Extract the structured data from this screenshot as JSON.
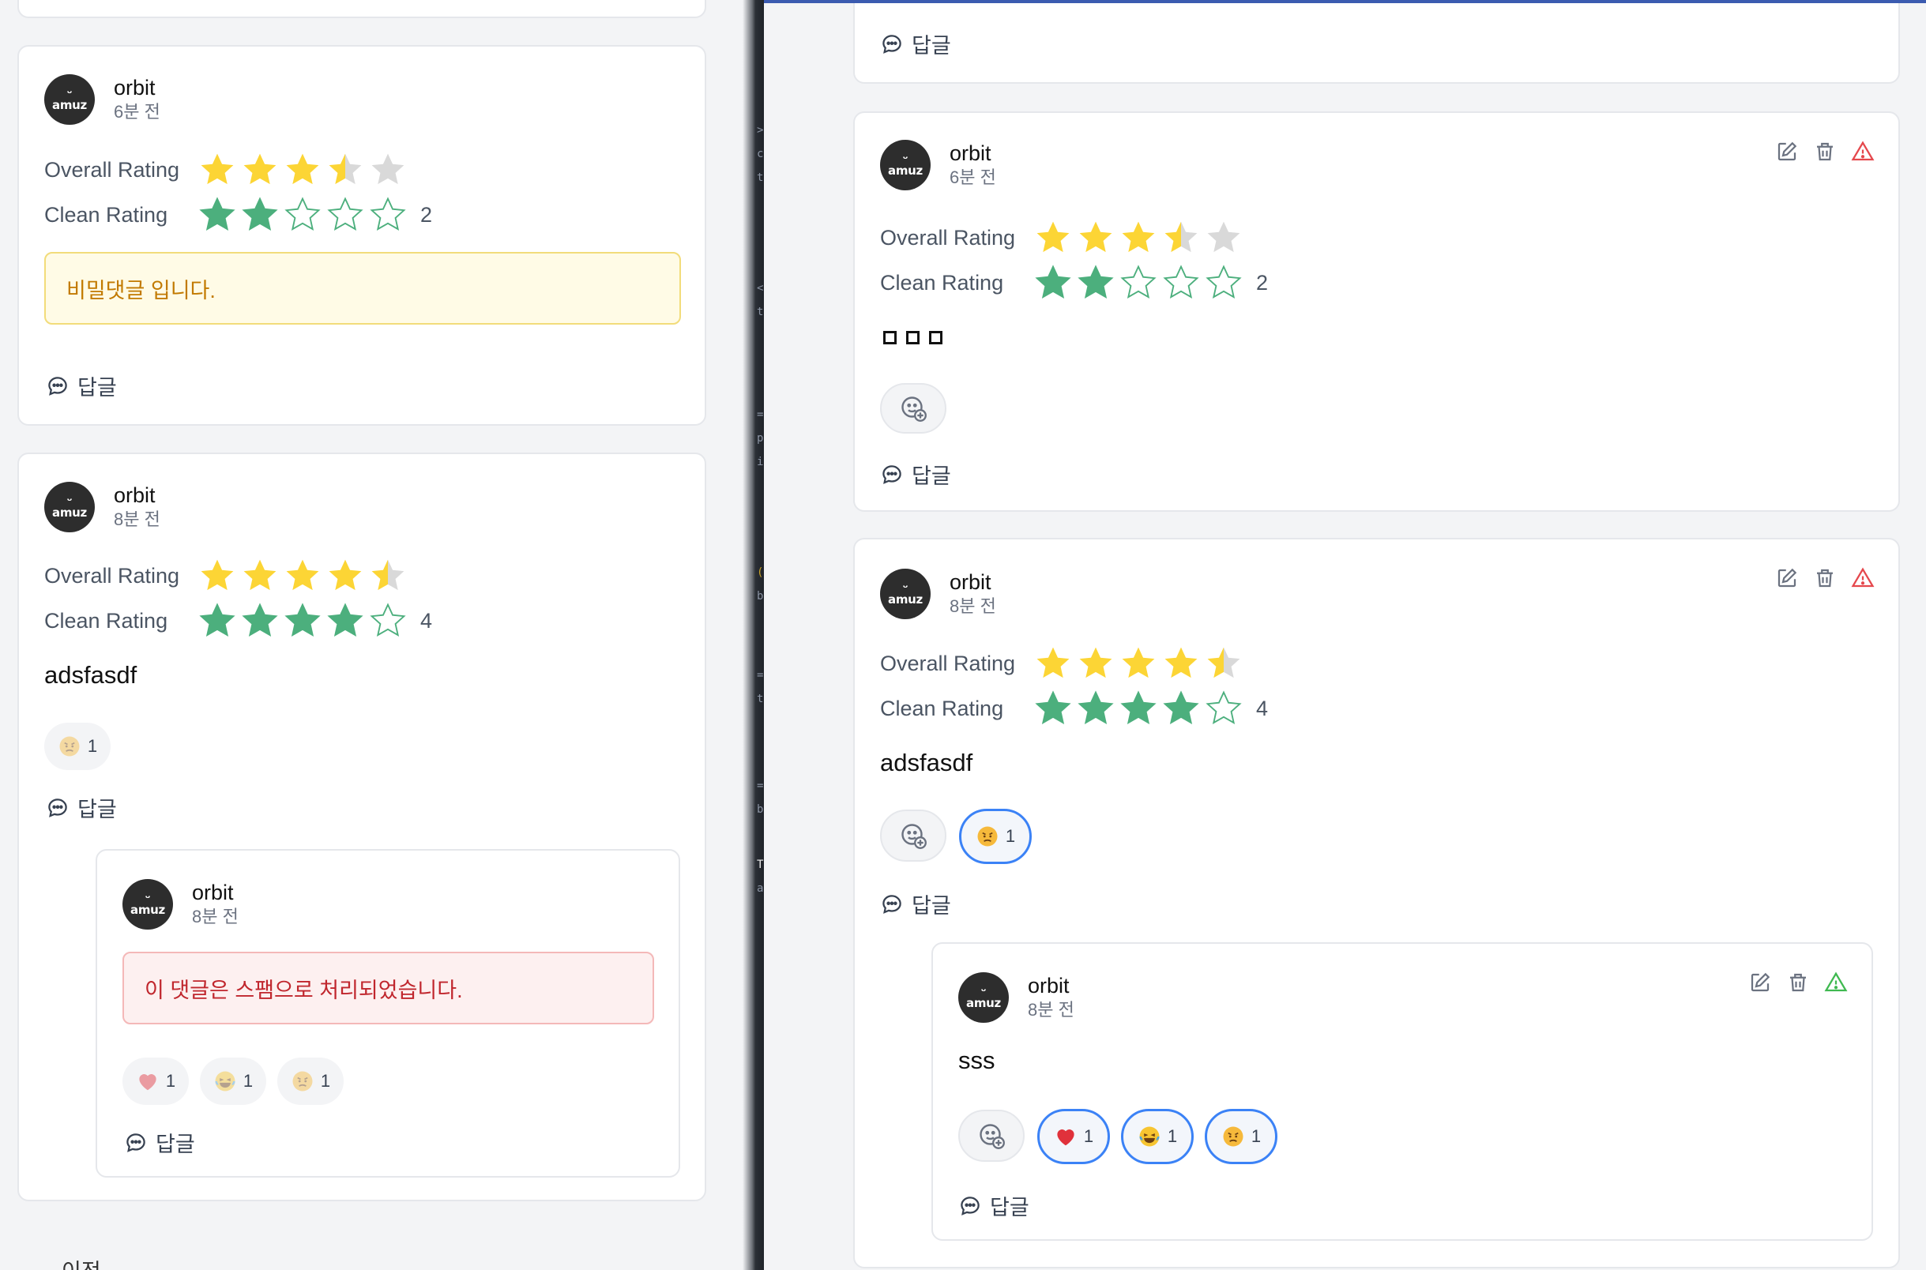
{
  "left": {
    "comments": [
      {
        "author": "orbit",
        "time": "6분 전",
        "overall_label": "Overall Rating",
        "overall_value": 3.5,
        "clean_label": "Clean Rating",
        "clean_value": 2,
        "clean_number": "2",
        "secret_text": "비밀댓글 입니다.",
        "reply_label": "답글"
      },
      {
        "author": "orbit",
        "time": "8분 전",
        "overall_label": "Overall Rating",
        "overall_value": 4.5,
        "clean_label": "Clean Rating",
        "clean_value": 4,
        "clean_number": "4",
        "body": "adsfasdf",
        "reaction_count": "1",
        "reply_label": "답글",
        "child": {
          "author": "orbit",
          "time": "8분 전",
          "spam_text": "이 댓글은 스팸으로 처리되었습니다.",
          "reactions": [
            {
              "icon": "heart-icon",
              "count": "1"
            },
            {
              "icon": "laugh-icon",
              "count": "1"
            },
            {
              "icon": "angry-icon",
              "count": "1"
            }
          ],
          "reply_label": "답글"
        }
      }
    ],
    "bottom_text": "이전"
  },
  "right": {
    "top_reply_label": "답글",
    "comments": [
      {
        "author": "orbit",
        "time": "6분 전",
        "overall_label": "Overall Rating",
        "overall_value": 3.5,
        "clean_label": "Clean Rating",
        "clean_value": 2,
        "clean_number": "2",
        "reply_label": "답글"
      },
      {
        "author": "orbit",
        "time": "8분 전",
        "overall_label": "Overall Rating",
        "overall_value": 4.5,
        "clean_label": "Clean Rating",
        "clean_value": 4,
        "clean_number": "4",
        "body": "adsfasdf",
        "reaction_count": "1",
        "reply_label": "답글",
        "child": {
          "author": "orbit",
          "time": "8분 전",
          "body": "sss",
          "reactions": [
            {
              "icon": "heart-icon",
              "count": "1"
            },
            {
              "icon": "laugh-icon",
              "count": "1"
            },
            {
              "icon": "angry-icon",
              "count": "1"
            }
          ],
          "reply_label": "답글"
        }
      }
    ]
  },
  "avatar": {
    "brand": "amuz",
    "smile": "ᵕ"
  },
  "gutter_code": [
    ">",
    "c",
    "t",
    "<",
    "t",
    "=",
    "p",
    "i",
    "(",
    "b",
    "=",
    "t",
    "=",
    "b",
    "T",
    "a"
  ],
  "colors": {
    "overall_star": "#fcd535",
    "overall_empty": "#d9d9d9",
    "clean_star": "#4caf7d",
    "clean_empty": "#cfd8dc",
    "selected_outline": "#3b82f6",
    "warn_red": "#e5484d",
    "warn_green": "#3fb950"
  }
}
